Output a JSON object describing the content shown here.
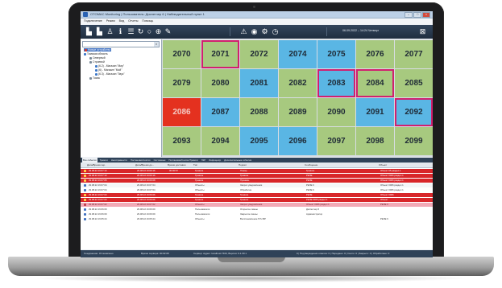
{
  "window": {
    "title": "OTOMAC Monitoring | Пользователь: Диспетчер 6 | Наблюдательный пункт 1",
    "buttons": [
      "–",
      "□",
      "×"
    ]
  },
  "menu": [
    "Подключение",
    "Режим",
    "Вид",
    "Отчеты",
    "Помощь"
  ],
  "toolbar": {
    "left_icons": [
      "panel-icon",
      "panel-icon",
      "user-icon",
      "info-icon",
      "list-icon",
      "refresh-icon",
      "search-icon",
      "zoom-icon",
      "wrench-icon"
    ],
    "right_icons": [
      "warning-icon",
      "eye-icon",
      "settings-icon",
      "clock-icon"
    ],
    "datetime": "06.09.2022 – 14:24  Четверг",
    "end_icon": "close-panel-icon"
  },
  "tree": {
    "items": [
      {
        "label": "Новые устройства",
        "level": 0,
        "selected": true,
        "color": "#d63a2c"
      },
      {
        "label": "Томская область",
        "level": 0,
        "color": "#3c78c8"
      },
      {
        "label": "Северный",
        "level": 1,
        "color": "#7a8a99"
      },
      {
        "label": "Строевой",
        "level": 1,
        "color": "#7a8a99"
      },
      {
        "label": "(6.2) - Магазин \"Мир\"",
        "level": 2,
        "color": "#3c78c8"
      },
      {
        "label": "(6) - Магазин \"Мой\"",
        "level": 2,
        "color": "#3c78c8"
      },
      {
        "label": "(6.3) - Магазин \"Звук\"",
        "level": 2,
        "color": "#3c78c8"
      },
      {
        "label": "Томск",
        "level": 1,
        "color": "#7a8a99"
      }
    ]
  },
  "grid": {
    "rows": [
      [
        {
          "n": "2070",
          "c": "green"
        },
        {
          "n": "2071",
          "c": "green",
          "sel": true
        },
        {
          "n": "2072",
          "c": "green"
        },
        {
          "n": "2074",
          "c": "blue"
        },
        {
          "n": "2075",
          "c": "blue"
        },
        {
          "n": "2076",
          "c": "green"
        },
        {
          "n": "2077",
          "c": "green"
        }
      ],
      [
        {
          "n": "2079",
          "c": "green"
        },
        {
          "n": "2080",
          "c": "green"
        },
        {
          "n": "2081",
          "c": "blue"
        },
        {
          "n": "2082",
          "c": "green"
        },
        {
          "n": "2083",
          "c": "blue",
          "sel": true
        },
        {
          "n": "2084",
          "c": "green",
          "sel": true
        },
        {
          "n": "2085",
          "c": "green"
        }
      ],
      [
        {
          "n": "2086",
          "c": "red"
        },
        {
          "n": "2087",
          "c": "blue"
        },
        {
          "n": "2088",
          "c": "green"
        },
        {
          "n": "2089",
          "c": "green"
        },
        {
          "n": "2090",
          "c": "green"
        },
        {
          "n": "2091",
          "c": "blue"
        },
        {
          "n": "2092",
          "c": "blue",
          "sel": true
        }
      ],
      [
        {
          "n": "2093",
          "c": "green"
        },
        {
          "n": "2094",
          "c": "green"
        },
        {
          "n": "2095",
          "c": "blue"
        },
        {
          "n": "2096",
          "c": "blue"
        },
        {
          "n": "2097",
          "c": "green"
        },
        {
          "n": "2098",
          "c": "green"
        },
        {
          "n": "2099",
          "c": "green"
        }
      ]
    ]
  },
  "tabs": [
    "Все события",
    "Тревоги",
    "Неисправности",
    "Постановки/снятия",
    "Системные",
    "Постановки/Снятия/Тревоги",
    "ПКР",
    "Инфоцентр",
    "Дополнительные события"
  ],
  "log": {
    "columns": [
      "Дата/Время сер.",
      "Дата/Время до...",
      "Время доставки",
      "Тип",
      "Подкат",
      "Сообщение",
      "Объект"
    ],
    "rows": [
      {
        "style": "red",
        "cells": [
          "29.08.22 16:07:13",
          "29.08.22 16:06:16",
          "00:00:57",
          "Тревога",
          "Пожар",
          "Тревога",
          "Объект 05  раздел 1"
        ]
      },
      {
        "style": "red",
        "cells": [
          "29.08.22 16:07:13",
          "29.08.22 16:06:16",
          "",
          "Тревога",
          "Тревога",
          "РЕЛЕ",
          "Объект 0006  раздел 1"
        ]
      },
      {
        "style": "red",
        "cells": [
          "29.08.22 16:07:05",
          "29.08.22 16:06:08",
          "",
          "Тревога",
          "Проникн.",
          "РЕЛЕ",
          "Объект 0006 раздел 1"
        ]
      },
      {
        "style": "grey",
        "cells": [
          "29.08.22 16:07:04",
          "29.08.22 16:07:04",
          "",
          "Объекты",
          "Запрос уведомления",
          "РЕЛЕ 6",
          "Объект 0006 раздел 1"
        ]
      },
      {
        "style": "white",
        "cells": [
          "29.08.22 16:07:04",
          "29.08.22 16:07:04",
          "",
          "Объекты",
          "Обработка",
          "РЕЛЕ 6",
          "Объект 0006 раздел 1"
        ]
      },
      {
        "style": "red",
        "cells": [
          "29.08.22 16:07:03",
          "29.08.22 16:06:06",
          "",
          "Тревога",
          "Тревога",
          "РЕЛЕ",
          "Объект 0006"
        ]
      },
      {
        "style": "red",
        "cells": [
          "29.08.22 16:07:03",
          "29.08.22 16:06:06",
          "",
          "Тревога",
          "Тревога",
          "РЕЛЕ 0006 раздел 1",
          "Объект"
        ]
      },
      {
        "style": "pink",
        "cells": [
          "29.08.22 16:07:02",
          "29.08.22 16:07:02",
          "",
          "Объекты",
          "Запрос уведомления",
          "Объект 0006 раздел 1",
          "РЕЛЕ 6"
        ]
      },
      {
        "style": "white",
        "cells": [
          "29.08.22 16:06:09",
          "29.08.22 16:06:09",
          "",
          "Пользователи",
          "Открытие смены",
          "Диспетчер 6",
          ""
        ]
      },
      {
        "style": "white",
        "cells": [
          "29.08.22 16:06:09",
          "29.08.22 16:06:09",
          "",
          "Пользователи",
          "Закрытие смены",
          "Администратор",
          ""
        ]
      },
      {
        "style": "white",
        "cells": [
          "29.08.22 16:05:24",
          "29.08.22 16:05:24",
          "",
          "Объекты",
          "Восстановление ГСЧ ВР",
          "",
          "РЕЛЕ 6"
        ]
      }
    ]
  },
  "statusbar": {
    "connection": "Соединение: Установлено",
    "server_time": "Время сервера: 00:02:08",
    "server": "Сервер: Адрес: localhost:7400, Версия: 6.1.30.1",
    "stats": "0 | Подтверждения ответов: 0 | Передано: 0 | Снято: 0 | Закрыто: 0 | Обработано: 0"
  }
}
